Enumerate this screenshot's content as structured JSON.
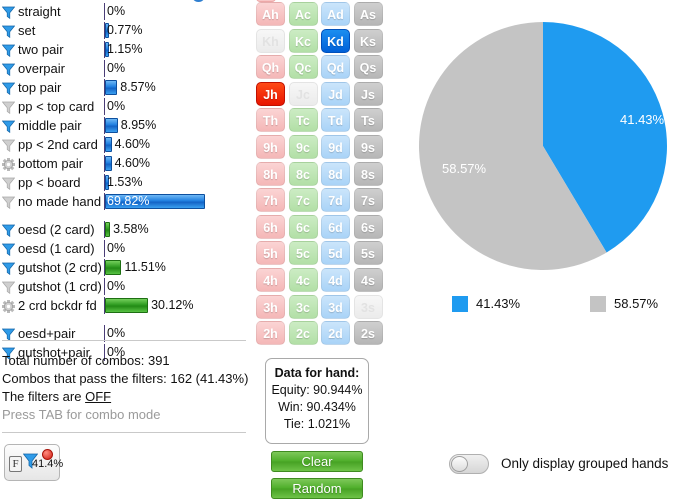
{
  "left_panel": {
    "made_hand_rows": [
      {
        "label": "straight",
        "value": "0%",
        "pct": 0,
        "icon": "filter-funnel-active-icon",
        "bar": "none"
      },
      {
        "label": "set",
        "value": "0.77%",
        "pct": 0.77,
        "icon": "filter-funnel-active-icon",
        "bar": "blue"
      },
      {
        "label": "two pair",
        "value": "1.15%",
        "pct": 1.15,
        "icon": "filter-funnel-active-icon",
        "bar": "blue"
      },
      {
        "label": "overpair",
        "value": "0%",
        "pct": 0,
        "icon": "filter-funnel-active-icon",
        "bar": "none"
      },
      {
        "label": "top pair",
        "value": "8.57%",
        "pct": 8.57,
        "icon": "filter-funnel-active-icon",
        "bar": "blue"
      },
      {
        "label": "pp < top card",
        "value": "0%",
        "pct": 0,
        "icon": "filter-funnel-inactive-icon",
        "bar": "none"
      },
      {
        "label": "middle pair",
        "value": "8.95%",
        "pct": 8.95,
        "icon": "filter-funnel-active-icon",
        "bar": "blue"
      },
      {
        "label": "pp < 2nd card",
        "value": "4.60%",
        "pct": 4.6,
        "icon": "filter-funnel-inactive-icon",
        "bar": "blue"
      },
      {
        "label": "bottom pair",
        "value": "4.60%",
        "pct": 4.6,
        "icon": "gear-icon",
        "bar": "blue"
      },
      {
        "label": "pp < board",
        "value": "1.53%",
        "pct": 1.53,
        "icon": "filter-funnel-inactive-icon",
        "bar": "blue"
      },
      {
        "label": "no made hand",
        "value": "69.82%",
        "pct": 69.82,
        "icon": "filter-funnel-inactive-icon",
        "bar": "blue",
        "label_inside": true
      }
    ],
    "draw_rows": [
      {
        "label": "oesd (2 card)",
        "value": "3.58%",
        "pct": 3.58,
        "icon": "filter-funnel-active-icon",
        "bar": "green"
      },
      {
        "label": "oesd (1 card)",
        "value": "0%",
        "pct": 0,
        "icon": "filter-funnel-active-icon",
        "bar": "none"
      },
      {
        "label": "gutshot (2 crd)",
        "value": "11.51%",
        "pct": 11.51,
        "icon": "filter-funnel-active-icon",
        "bar": "green"
      },
      {
        "label": "gutshot (1 crd)",
        "value": "0%",
        "pct": 0,
        "icon": "filter-funnel-inactive-icon",
        "bar": "none"
      },
      {
        "label": "2 crd bckdr fd",
        "value": "30.12%",
        "pct": 30.12,
        "icon": "gear-icon",
        "bar": "green"
      }
    ],
    "combo_rows": [
      {
        "label": "oesd+pair",
        "value": "0%",
        "pct": 0,
        "icon": "filter-funnel-active-icon",
        "bar": "none"
      },
      {
        "label": "gutshot+pair",
        "value": "0%",
        "pct": 0,
        "icon": "filter-funnel-active-icon",
        "bar": "none"
      }
    ],
    "summary": {
      "total_combos": "Total number of combos: 391",
      "passing_combos": "Combos that pass the filters: 162 (41.43%)",
      "filters_state_prefix": "The filters are ",
      "filters_state": "OFF",
      "hint": "Press TAB for combo mode"
    },
    "filter_badge": {
      "prefix": "F",
      "percent": "41.4%"
    }
  },
  "card_grid": {
    "ranks": [
      "A",
      "K",
      "Q",
      "J",
      "T",
      "9",
      "8",
      "7",
      "6",
      "5",
      "4",
      "3",
      "2"
    ],
    "suits": [
      "h",
      "c",
      "d",
      "s"
    ],
    "rows": [
      [
        {
          "label": "Ah",
          "state": "normal",
          "suit": "h"
        },
        {
          "label": "Ac",
          "state": "normal",
          "suit": "c"
        },
        {
          "label": "Ad",
          "state": "normal",
          "suit": "d"
        },
        {
          "label": "As",
          "state": "normal",
          "suit": "s"
        }
      ],
      [
        {
          "label": "Kh",
          "state": "dead",
          "suit": "h"
        },
        {
          "label": "Kc",
          "state": "normal",
          "suit": "c"
        },
        {
          "label": "Kd",
          "state": "selected",
          "suit": "d"
        },
        {
          "label": "Ks",
          "state": "normal",
          "suit": "s"
        }
      ],
      [
        {
          "label": "Qh",
          "state": "normal",
          "suit": "h"
        },
        {
          "label": "Qc",
          "state": "normal",
          "suit": "c"
        },
        {
          "label": "Qd",
          "state": "normal",
          "suit": "d"
        },
        {
          "label": "Qs",
          "state": "normal",
          "suit": "s"
        }
      ],
      [
        {
          "label": "Jh",
          "state": "selected",
          "suit": "h"
        },
        {
          "label": "Jc",
          "state": "dead",
          "suit": "c"
        },
        {
          "label": "Jd",
          "state": "normal",
          "suit": "d"
        },
        {
          "label": "Js",
          "state": "normal",
          "suit": "s"
        }
      ],
      [
        {
          "label": "Th",
          "state": "normal",
          "suit": "h"
        },
        {
          "label": "Tc",
          "state": "normal",
          "suit": "c"
        },
        {
          "label": "Td",
          "state": "normal",
          "suit": "d"
        },
        {
          "label": "Ts",
          "state": "normal",
          "suit": "s"
        }
      ],
      [
        {
          "label": "9h",
          "state": "normal",
          "suit": "h"
        },
        {
          "label": "9c",
          "state": "normal",
          "suit": "c"
        },
        {
          "label": "9d",
          "state": "normal",
          "suit": "d"
        },
        {
          "label": "9s",
          "state": "normal",
          "suit": "s"
        }
      ],
      [
        {
          "label": "8h",
          "state": "normal",
          "suit": "h"
        },
        {
          "label": "8c",
          "state": "normal",
          "suit": "c"
        },
        {
          "label": "8d",
          "state": "normal",
          "suit": "d"
        },
        {
          "label": "8s",
          "state": "normal",
          "suit": "s"
        }
      ],
      [
        {
          "label": "7h",
          "state": "normal",
          "suit": "h"
        },
        {
          "label": "7c",
          "state": "normal",
          "suit": "c"
        },
        {
          "label": "7d",
          "state": "normal",
          "suit": "d"
        },
        {
          "label": "7s",
          "state": "normal",
          "suit": "s"
        }
      ],
      [
        {
          "label": "6h",
          "state": "normal",
          "suit": "h"
        },
        {
          "label": "6c",
          "state": "normal",
          "suit": "c"
        },
        {
          "label": "6d",
          "state": "normal",
          "suit": "d"
        },
        {
          "label": "6s",
          "state": "normal",
          "suit": "s"
        }
      ],
      [
        {
          "label": "5h",
          "state": "normal",
          "suit": "h"
        },
        {
          "label": "5c",
          "state": "normal",
          "suit": "c"
        },
        {
          "label": "5d",
          "state": "normal",
          "suit": "d"
        },
        {
          "label": "5s",
          "state": "normal",
          "suit": "s"
        }
      ],
      [
        {
          "label": "4h",
          "state": "normal",
          "suit": "h"
        },
        {
          "label": "4c",
          "state": "normal",
          "suit": "c"
        },
        {
          "label": "4d",
          "state": "normal",
          "suit": "d"
        },
        {
          "label": "4s",
          "state": "normal",
          "suit": "s"
        }
      ],
      [
        {
          "label": "3h",
          "state": "normal",
          "suit": "h"
        },
        {
          "label": "3c",
          "state": "normal",
          "suit": "c"
        },
        {
          "label": "3d",
          "state": "normal",
          "suit": "d"
        },
        {
          "label": "3s",
          "state": "dead",
          "suit": "s"
        }
      ],
      [
        {
          "label": "2h",
          "state": "normal",
          "suit": "h"
        },
        {
          "label": "2c",
          "state": "normal",
          "suit": "c"
        },
        {
          "label": "2d",
          "state": "normal",
          "suit": "d"
        },
        {
          "label": "2s",
          "state": "normal",
          "suit": "s"
        }
      ]
    ]
  },
  "data_box": {
    "title": "Data for hand:",
    "equity": "Equity: 90.944%",
    "win": "Win: 90.434%",
    "tie": "Tie: 1.021%"
  },
  "buttons": {
    "clear": "Clear",
    "random": "Random"
  },
  "toggle": {
    "label": "Only display grouped hands",
    "state": "off"
  },
  "chart_data": {
    "type": "pie",
    "title": "",
    "labels": [
      "41.43%",
      "58.57%"
    ],
    "values": [
      41.43,
      58.57
    ],
    "colors": [
      "#1f9bf0",
      "#c4c4c4"
    ],
    "slice_labels": [
      "41.43%",
      "58.57%"
    ],
    "legend": [
      {
        "label": "41.43%",
        "color": "#1f9bf0"
      },
      {
        "label": "58.57%",
        "color": "#c4c4c4"
      }
    ],
    "legend_position": "bottom",
    "start_angle_deg": 0,
    "direction": "clockwise",
    "grid": false
  }
}
